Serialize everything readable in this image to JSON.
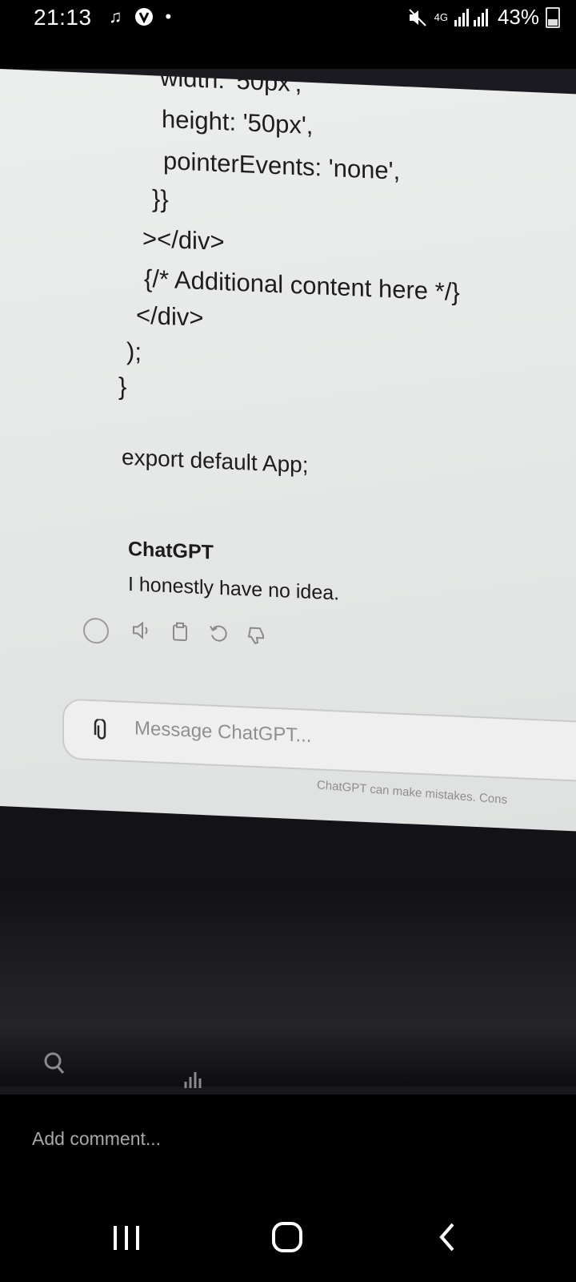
{
  "status_bar": {
    "time": "21:13",
    "left_icons": [
      "music-note-icon",
      "circle-logo-icon",
      "dot-icon"
    ],
    "network": "4G",
    "battery_percent": "43%",
    "battery_level": 0.43
  },
  "photo": {
    "code_lines": [
      "width: '50px',",
      "height: '50px',",
      "pointerEvents: 'none',",
      "}}",
      "></div>",
      "{/* Additional content here */}",
      "</div>",
      ");",
      "}",
      "export default App;"
    ],
    "chat": {
      "name": "ChatGPT",
      "message": "I honestly have no idea.",
      "actions": [
        "speaker-icon",
        "copy-icon",
        "regenerate-icon",
        "thumbs-down-icon"
      ]
    },
    "composer": {
      "placeholder": "Message ChatGPT..."
    },
    "disclaimer": "ChatGPT can make mistakes. Cons"
  },
  "comment": {
    "placeholder": "Add comment..."
  },
  "nav": {
    "buttons": [
      "recent-apps-icon",
      "home-icon",
      "back-icon"
    ]
  }
}
